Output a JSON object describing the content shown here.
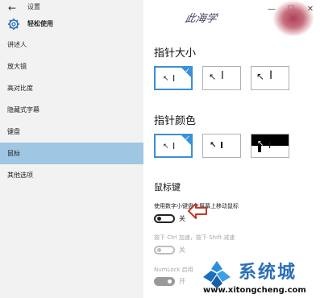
{
  "window": {
    "title": "设置",
    "controls": {
      "minimize": "—",
      "maximize": "☐",
      "close": "✕"
    }
  },
  "header": {
    "title": "轻松使用"
  },
  "sidebar": {
    "items": [
      {
        "label": "讲述人",
        "active": false
      },
      {
        "label": "放大镜",
        "active": false
      },
      {
        "label": "高对比度",
        "active": false
      },
      {
        "label": "隐藏式字幕",
        "active": false
      },
      {
        "label": "键盘",
        "active": false
      },
      {
        "label": "鼠标",
        "active": true
      },
      {
        "label": "其他选项",
        "active": false
      }
    ]
  },
  "pointer_size": {
    "title": "指针大小",
    "options": [
      "small",
      "medium",
      "large"
    ],
    "selected": "small"
  },
  "pointer_color": {
    "title": "指针颜色",
    "options": [
      "white",
      "black",
      "inverted"
    ],
    "selected": "white"
  },
  "mouse_keys": {
    "title": "鼠标键",
    "use_numpad_label": "使用数字小键盘在屏幕上移动鼠标",
    "use_numpad_state": "关",
    "ctrl_shift_label": "按下 Ctrl 加速，按下 Shift 减速",
    "ctrl_shift_state": "关",
    "numlock_label": "NumLock 启用",
    "numlock_state": "开"
  },
  "watermarks": {
    "top": "此海学",
    "brand": "系统城",
    "url": "www.xitongcheng.com"
  },
  "colors": {
    "accent": "#3a90d8",
    "active_nav": "#9fc6e3",
    "arrow": "#c0392b"
  }
}
